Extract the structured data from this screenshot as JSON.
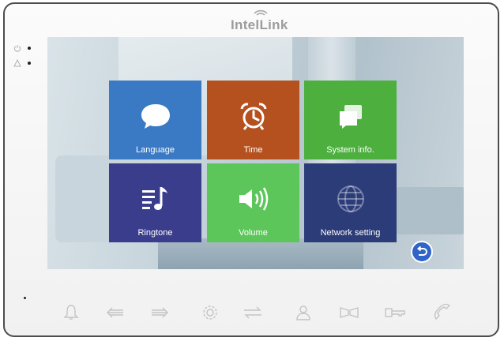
{
  "brand": {
    "name": "IntelLink"
  },
  "menu": {
    "tiles": [
      {
        "label": "Language",
        "icon": "speech-bubble-icon",
        "color": "#3a79c3"
      },
      {
        "label": "Time",
        "icon": "alarm-clock-icon",
        "color": "#b5501f"
      },
      {
        "label": "System info.",
        "icon": "windows-stack-icon",
        "color": "#4caf3e"
      },
      {
        "label": "Ringtone",
        "icon": "music-note-icon",
        "color": "#3a3d8c"
      },
      {
        "label": "Volume",
        "icon": "speaker-icon",
        "color": "#5dc65a"
      },
      {
        "label": "Network setting",
        "icon": "globe-icon",
        "color": "#2c3c78"
      }
    ]
  },
  "buttons": {
    "back_icon": "return-arrow-icon",
    "hardware": [
      "bell-icon",
      "arrow-left-icon",
      "arrow-right-icon",
      "gear-icon",
      "transfer-icon",
      "person-icon",
      "gate-icon",
      "key-icon",
      "phone-icon"
    ]
  }
}
